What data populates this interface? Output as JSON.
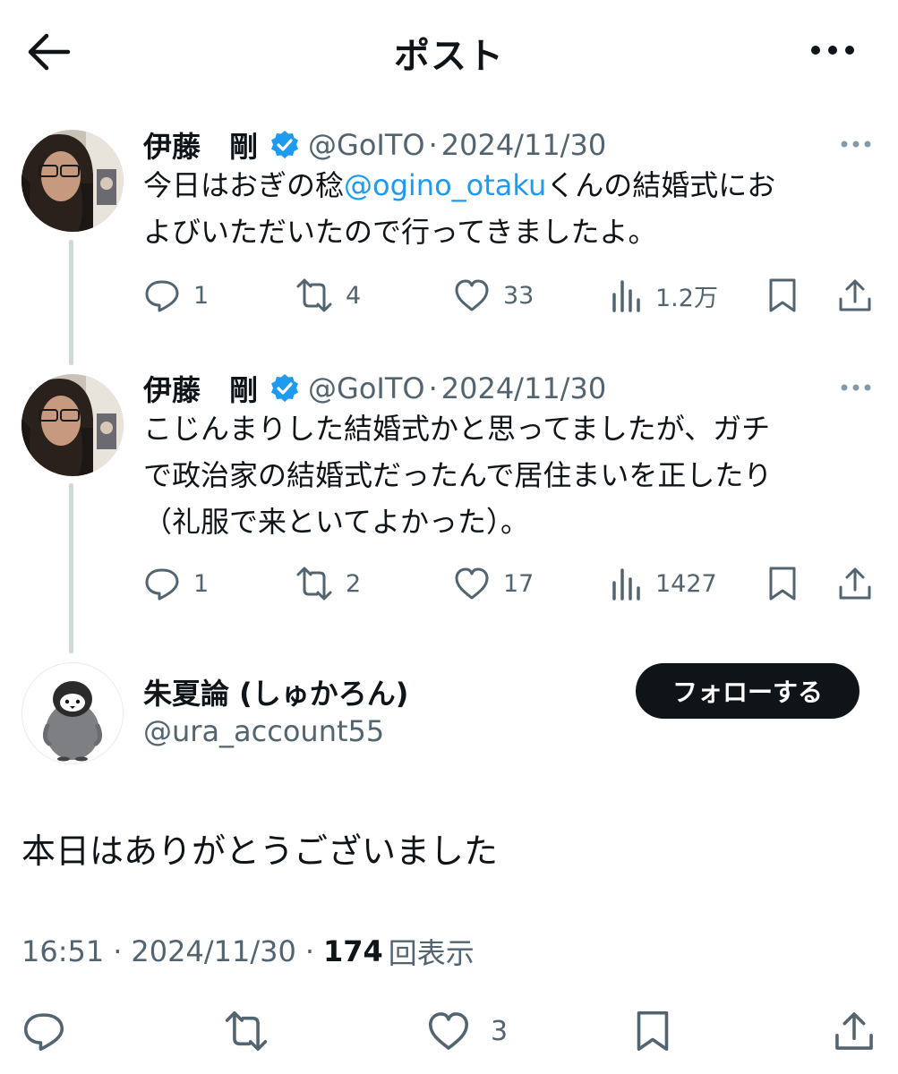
{
  "header": {
    "title": "ポスト"
  },
  "tweets": [
    {
      "name": "伊藤　剛",
      "handle": "@GoITO",
      "separator": "·",
      "date": "2024/11/30",
      "text_before": "今日はおぎの稔",
      "mention": "@ogino_otaku",
      "text_after": "くんの結婚式にお",
      "text_line2": "よびいただいたので行ってきましたよ。",
      "replies": "1",
      "reposts": "4",
      "likes": "33",
      "views": "1.2万"
    },
    {
      "name": "伊藤　剛",
      "handle": "@GoITO",
      "separator": "·",
      "date": "2024/11/30",
      "text_line1": "こじんまりした結婚式かと思ってましたが、ガチ",
      "text_line2": "で政治家の結婚式だったんで居住まいを正したり",
      "text_line3": "（礼服で来といてよかった）。",
      "replies": "1",
      "reposts": "2",
      "likes": "17",
      "views": "1427"
    }
  ],
  "main_post": {
    "name": "朱夏論 (しゅかろん)",
    "handle": "@ura_account55",
    "follow_label": "フォローする",
    "text": "本日はありがとうございました",
    "time": "16:51",
    "separator": "·",
    "date": "2024/11/30",
    "views_count": "174",
    "views_label": "回表示",
    "likes": "3"
  },
  "colors": {
    "text": "#0f1419",
    "secondary": "#536471",
    "accent": "#1d9bf0",
    "thread_line": "#cfd9de"
  },
  "icons": [
    "back-arrow-icon",
    "more-icon",
    "verified-badge-icon",
    "reply-icon",
    "repost-icon",
    "like-icon",
    "views-icon",
    "bookmark-icon",
    "share-icon"
  ]
}
